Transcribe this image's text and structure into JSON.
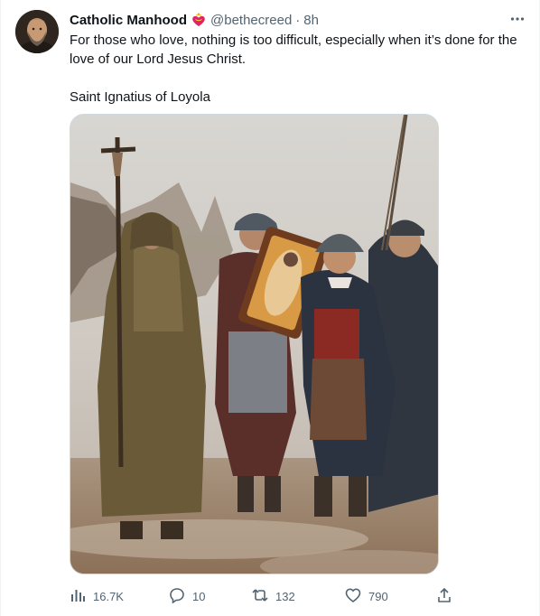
{
  "tweet": {
    "author_name": "Catholic Manhood",
    "handle": "@bethecreed",
    "separator": "·",
    "time": "8h",
    "text_line": "For those who love, nothing is too difficult, especially when it’s done for the love of our Lord Jesus Christ.",
    "signature": "Saint Ignatius of Loyola",
    "badge_icon": "sacred-heart-icon",
    "more_icon": "more-horizontal-icon",
    "media_description_icon": "painting-image"
  },
  "actions": {
    "views": "16.7K",
    "replies": "10",
    "retweets": "132",
    "likes": "790"
  },
  "colors": {
    "text_primary": "#0f1419",
    "text_secondary": "#536471",
    "border": "#cfd9de",
    "badge_red": "#e0245e"
  }
}
